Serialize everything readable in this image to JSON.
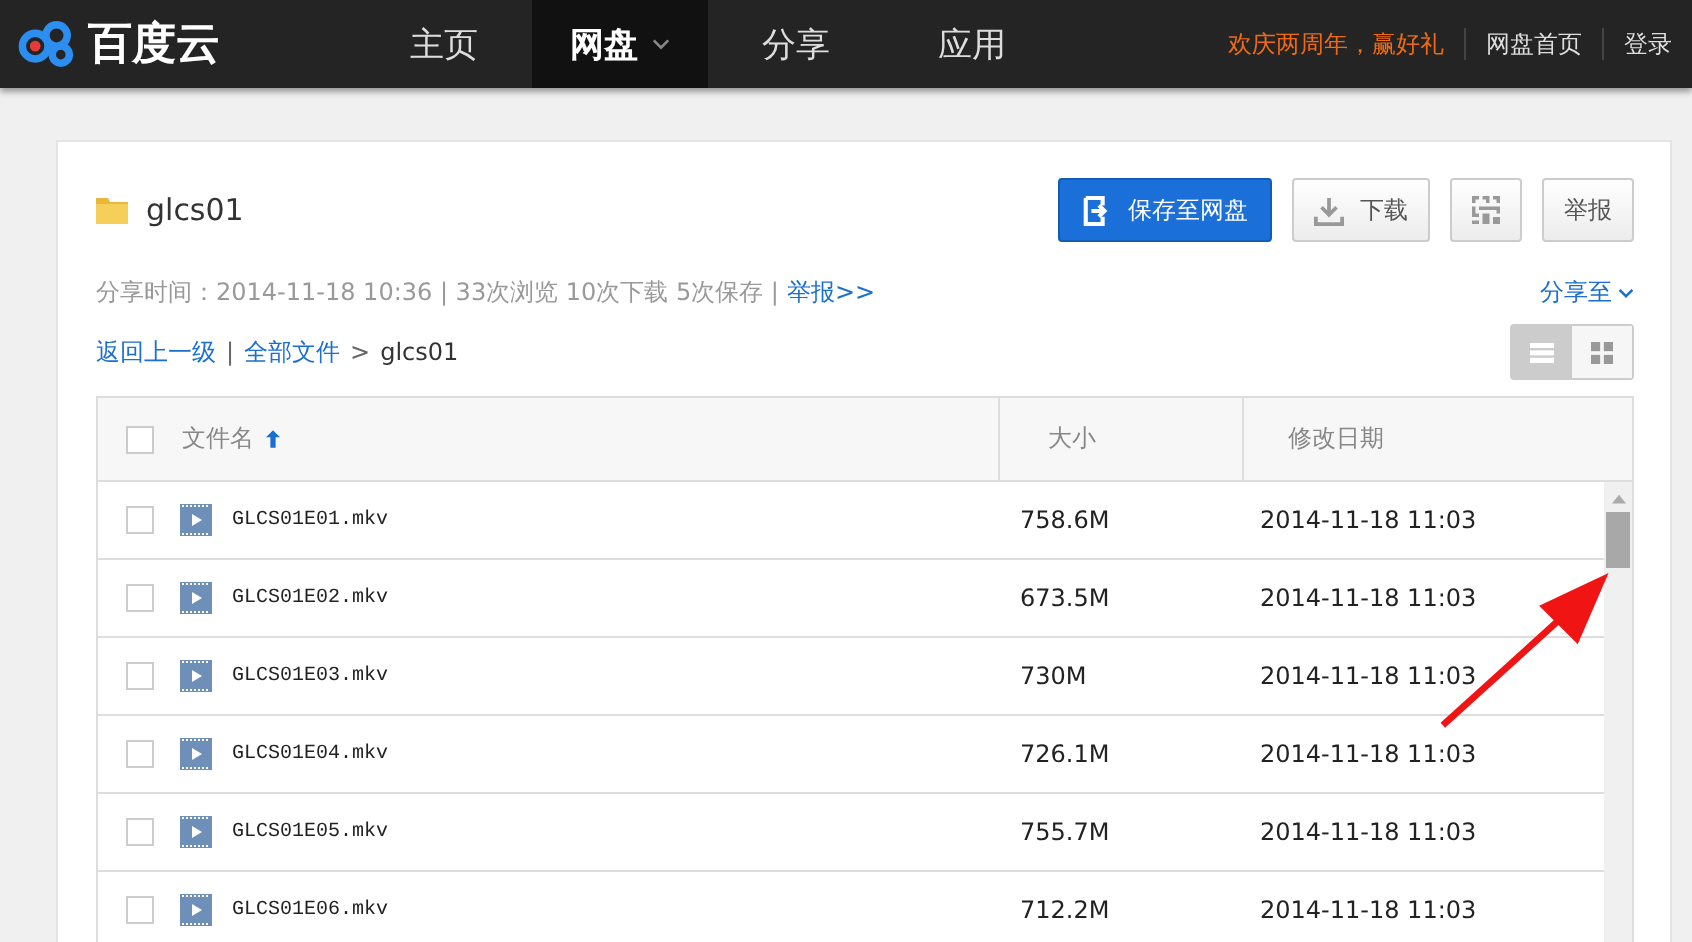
{
  "header": {
    "logo": "百度云",
    "nav": [
      {
        "label": "主页",
        "selected": false,
        "dropdown": false
      },
      {
        "label": "网盘",
        "selected": true,
        "dropdown": true
      },
      {
        "label": "分享",
        "selected": false,
        "dropdown": false
      },
      {
        "label": "应用",
        "selected": false,
        "dropdown": false
      }
    ],
    "promo": "欢庆两周年，赢好礼",
    "links": [
      "网盘首页",
      "登录"
    ]
  },
  "folder": {
    "title": "glcs01",
    "meta": "分享时间：2014-11-18 10:36 | 33次浏览 10次下载 5次保存 |",
    "report_link": "举报>>",
    "share_to": "分享至"
  },
  "actions": {
    "save": "保存至网盘",
    "download": "下载",
    "report": "举报"
  },
  "breadcrumb": {
    "back": "返回上一级",
    "separator": "|",
    "all": "全部文件",
    "arrow": ">",
    "current": "glcs01"
  },
  "view_toggle": [
    {
      "kind": "list",
      "selected": true
    },
    {
      "kind": "grid",
      "selected": false
    }
  ],
  "table": {
    "select_all_checked": false,
    "columns": [
      "文件名",
      "大小",
      "修改日期"
    ],
    "rows": [
      {
        "name": "GLCS01E01.mkv",
        "size": "758.6M",
        "date": "2014-11-18 11:03",
        "checked": false
      },
      {
        "name": "GLCS01E02.mkv",
        "size": "673.5M",
        "date": "2014-11-18 11:03",
        "checked": false
      },
      {
        "name": "GLCS01E03.mkv",
        "size": "730M",
        "date": "2014-11-18 11:03",
        "checked": false
      },
      {
        "name": "GLCS01E04.mkv",
        "size": "726.1M",
        "date": "2014-11-18 11:03",
        "checked": false
      },
      {
        "name": "GLCS01E05.mkv",
        "size": "755.7M",
        "date": "2014-11-18 11:03",
        "checked": false
      },
      {
        "name": "GLCS01E06.mkv",
        "size": "712.2M",
        "date": "2014-11-18 11:03",
        "checked": false
      }
    ]
  }
}
